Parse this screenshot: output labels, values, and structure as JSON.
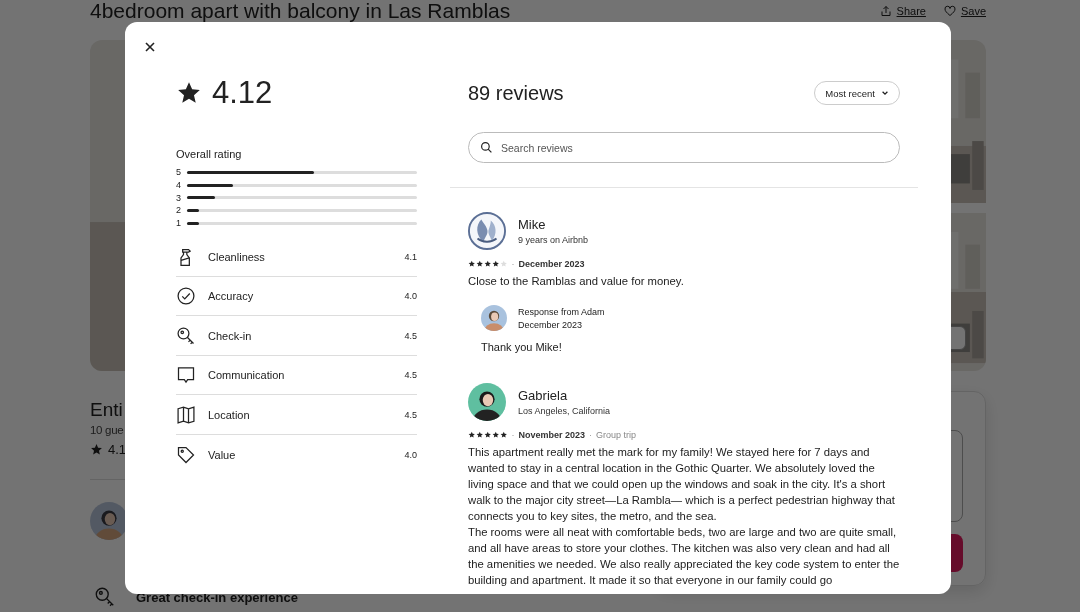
{
  "page": {
    "title": "4bedroom apart with balcony in Las Ramblas",
    "actions": [
      {
        "kind": "share",
        "label": "Share"
      },
      {
        "kind": "save",
        "label": "Save"
      }
    ]
  },
  "listing": {
    "title": "Enti",
    "guests": "10 gue",
    "rating": "4.1",
    "highlight": "Great check-in experience"
  },
  "modal": {
    "rating": "4.12",
    "overall_label": "Overall rating",
    "distribution": [
      {
        "label": "5",
        "level": 0.55
      },
      {
        "label": "4",
        "level": 0.2
      },
      {
        "label": "3",
        "level": 0.12
      },
      {
        "label": "2",
        "level": 0.05
      },
      {
        "label": "1",
        "level": 0.05
      }
    ],
    "categories": [
      {
        "kind": "cleanliness",
        "label": "Cleanliness",
        "value": "4.1"
      },
      {
        "kind": "accuracy",
        "label": "Accuracy",
        "value": "4.0"
      },
      {
        "kind": "checkin",
        "label": "Check-in",
        "value": "4.5"
      },
      {
        "kind": "communication",
        "label": "Communication",
        "value": "4.5"
      },
      {
        "kind": "location",
        "label": "Location",
        "value": "4.5"
      },
      {
        "kind": "value",
        "label": "Value",
        "value": "4.0"
      }
    ],
    "count": "89 reviews",
    "sort": "Most recent",
    "search": {
      "placeholder": "Search reviews"
    },
    "separator": "·",
    "reviews": [
      {
        "name": "Mike",
        "subtitle": "9 years on Airbnb",
        "stars": 4,
        "date": "December 2023",
        "paragraphs": [
          "Close to the Ramblas and value for money."
        ],
        "response": {
          "title": "Response from Adam",
          "date": "December 2023",
          "text": "Thank you Mike!"
        }
      },
      {
        "name": "Gabriela",
        "subtitle": "Los Angeles, California",
        "stars": 5,
        "date": "November 2023",
        "trip": "Group trip",
        "paragraphs": [
          "This apartment really met the mark for my family! We stayed here for 7 days and wanted to stay in a central location in the Gothic Quarter. We absolutely loved the living space and that we could open up the windows and soak in the city. It's a short walk to the major city street—La Rambla— which is a perfect pedestrian highway that connects you to key sites, the metro, and the sea.",
          "The rooms were all neat with comfortable beds, two are large and two are quite small, and all have areas to store your clothes. The kitchen was also very clean and had all the amenities we needed. We also really appreciated the key code system to enter the building and apartment. It made it so that everyone in our family could go"
        ]
      }
    ]
  }
}
